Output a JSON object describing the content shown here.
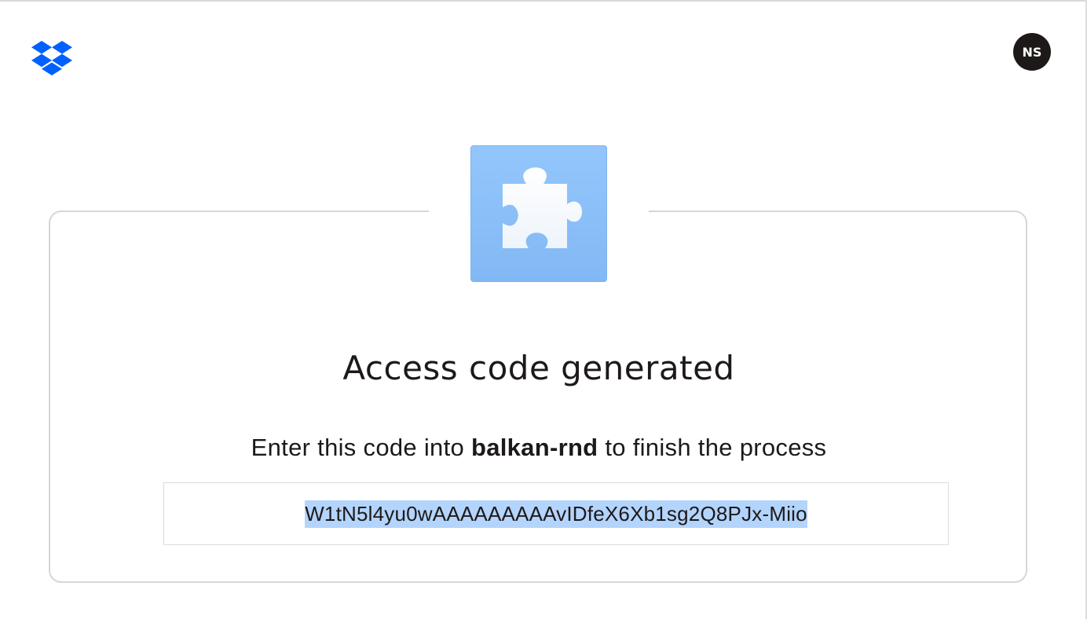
{
  "header": {
    "logo_icon": "dropbox-logo-icon",
    "brand_color": "#0061fe",
    "user_initials": "NS"
  },
  "app_icon": {
    "icon": "puzzle-piece-icon",
    "background": "#8dc0f9"
  },
  "main": {
    "title": "Access code generated",
    "instruction_prefix": "Enter this code into ",
    "app_name": "balkan-rnd",
    "instruction_suffix": " to finish the process",
    "access_code": "W1tN5l4yu0wAAAAAAAAAvIDfeX6Xb1sg2Q8PJx-Miio"
  }
}
